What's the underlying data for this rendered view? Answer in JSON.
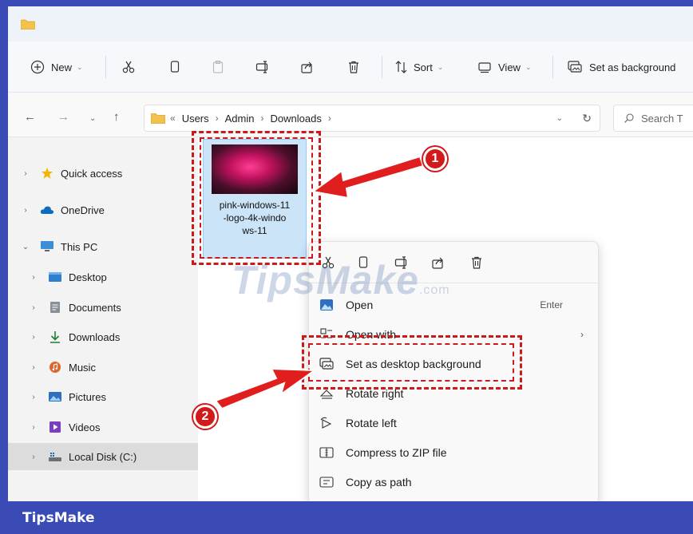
{
  "toolbar": {
    "new_label": "New",
    "sort_label": "Sort",
    "view_label": "View",
    "set_bg_label": "Set as background"
  },
  "address": {
    "overflow": "«",
    "crumbs": [
      "Users",
      "Admin",
      "Downloads"
    ],
    "search_placeholder": "Search T"
  },
  "sidebar": {
    "items": [
      {
        "label": "Quick access",
        "icon": "star-icon"
      },
      {
        "label": "OneDrive",
        "icon": "cloud-icon"
      },
      {
        "label": "This PC",
        "icon": "monitor-icon"
      },
      {
        "label": "Desktop",
        "icon": "desktop-icon"
      },
      {
        "label": "Documents",
        "icon": "documents-icon"
      },
      {
        "label": "Downloads",
        "icon": "download-icon"
      },
      {
        "label": "Music",
        "icon": "music-icon"
      },
      {
        "label": "Pictures",
        "icon": "pictures-icon"
      },
      {
        "label": "Videos",
        "icon": "videos-icon"
      },
      {
        "label": "Local Disk (C:)",
        "icon": "drive-icon"
      }
    ]
  },
  "file": {
    "name_line1": "pink-windows-11",
    "name_line2": "-logo-4k-windo",
    "name_line3": "ws-11"
  },
  "context_menu": {
    "open": "Open",
    "open_shortcut": "Enter",
    "open_with": "Open with",
    "set_desktop_bg": "Set as desktop background",
    "rotate_right": "Rotate right",
    "rotate_left": "Rotate left",
    "compress_zip": "Compress to ZIP file",
    "copy_path": "Copy as path"
  },
  "annotations": {
    "step1": "1",
    "step2": "2"
  },
  "watermark": {
    "brand": "TipsMake",
    "suffix": ".com"
  },
  "footer": {
    "brand": "TipsMake"
  },
  "colors": {
    "frame": "#3a4bb5",
    "highlight": "#cc1a1a",
    "selection": "#cce4f7"
  }
}
